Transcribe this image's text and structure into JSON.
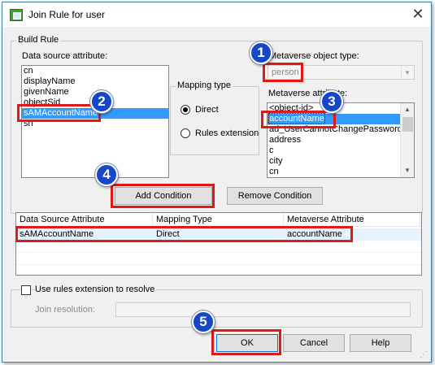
{
  "window": {
    "title": "Join Rule for user",
    "close_glyph": "✕"
  },
  "build_rule": {
    "legend": "Build Rule",
    "data_source_label": "Data source attribute:",
    "data_source_items": [
      "cn",
      "displayName",
      "givenName",
      "objectSid",
      "sAMAccountName",
      "sn"
    ],
    "data_source_selected": "sAMAccountName",
    "metaverse_object_type_label": "Metaverse object type:",
    "metaverse_object_type_value": "person",
    "mapping_type_legend": "Mapping type",
    "mapping_direct_label": "Direct",
    "mapping_rules_ext_label": "Rules extension",
    "mapping_selected": "Direct",
    "metaverse_attribute_label": "Metaverse attribute:",
    "metaverse_attribute_items": [
      "<object-id>",
      "accountName",
      "ad_UserCannotChangePassword",
      "address",
      "c",
      "city",
      "cn"
    ],
    "metaverse_attribute_selected": "accountName",
    "add_condition": "Add Condition",
    "remove_condition": "Remove Condition"
  },
  "conditions_table": {
    "columns": [
      "Data Source Attribute",
      "Mapping Type",
      "Metaverse Attribute"
    ],
    "rows": [
      [
        "sAMAccountName",
        "Direct",
        "accountName"
      ]
    ]
  },
  "resolution": {
    "checkbox_label": "Use rules extension to resolve",
    "checked": false,
    "join_resolution_label": "Join resolution:",
    "join_resolution_value": ""
  },
  "footer": {
    "ok": "OK",
    "cancel": "Cancel",
    "help": "Help"
  },
  "annotations": {
    "markers": [
      "1",
      "2",
      "3",
      "4",
      "5"
    ],
    "marker_color": "#1547c7",
    "highlight_color": "#e01818"
  },
  "icons": {
    "title_icon": "window-app-icon",
    "dropdown": "▼",
    "scroll_up": "▲",
    "scroll_down": "▼",
    "grip": "⋰"
  }
}
